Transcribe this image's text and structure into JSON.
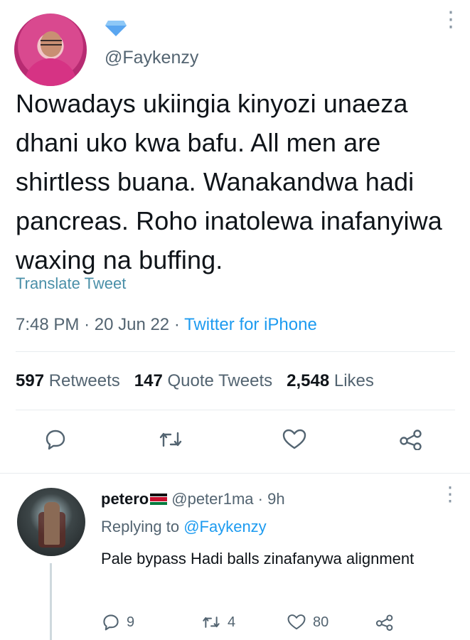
{
  "tweet": {
    "handle": "@Faykenzy",
    "text": "Nowadays ukiingia kinyozi unaeza dhani uko kwa bafu. All men are shirtless buana. Wanakandwa hadi pancreas. Roho inatolewa inafanyiwa waxing na buffing.",
    "translate_label": "Translate Tweet",
    "time": "7:48 PM",
    "date": "20 Jun 22",
    "source": "Twitter for iPhone",
    "retweets_count": "597",
    "retweets_label": "Retweets",
    "quotes_count": "147",
    "quotes_label": "Quote Tweets",
    "likes_count": "2,548",
    "likes_label": "Likes",
    "icons": [
      "verified-diamond-icon",
      "more-icon",
      "reply-icon",
      "retweet-icon",
      "like-icon",
      "share-icon"
    ]
  },
  "reply": {
    "name": "petero",
    "handle": "@peter1ma",
    "age": "9h",
    "replying_prefix": "Replying to",
    "replying_handle": "@Faykenzy",
    "text": "Pale bypass Hadi balls zinafanywa alignment",
    "reply_count": "9",
    "retweet_count": "4",
    "like_count": "80"
  },
  "colors": {
    "text": "#0f1419",
    "secondary": "#536471",
    "link": "#1d9bf0",
    "divider": "#e8ecef"
  }
}
